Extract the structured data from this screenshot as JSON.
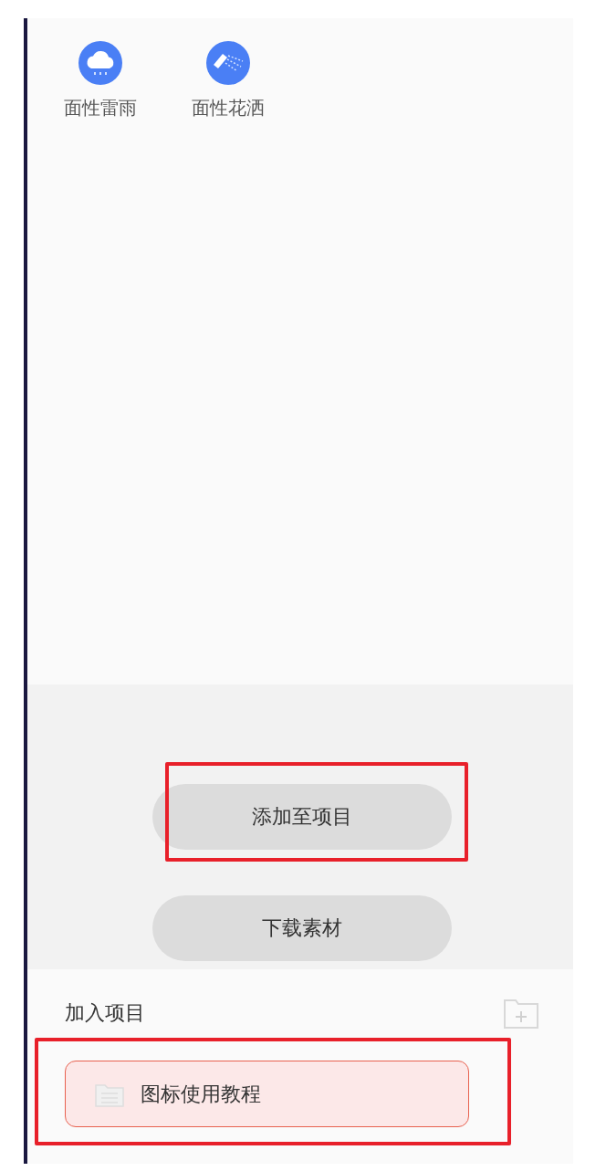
{
  "icons": [
    {
      "kind": "rain",
      "label": "面性雷雨"
    },
    {
      "kind": "shower",
      "label": "面性花洒"
    }
  ],
  "buttons": [
    {
      "label": "添加至项目",
      "highlighted": true
    },
    {
      "label": "下载素材",
      "highlighted": false
    }
  ],
  "projects": {
    "title": "加入项目",
    "items": [
      {
        "label": "图标使用教程",
        "selected": true,
        "highlighted": true
      }
    ]
  }
}
